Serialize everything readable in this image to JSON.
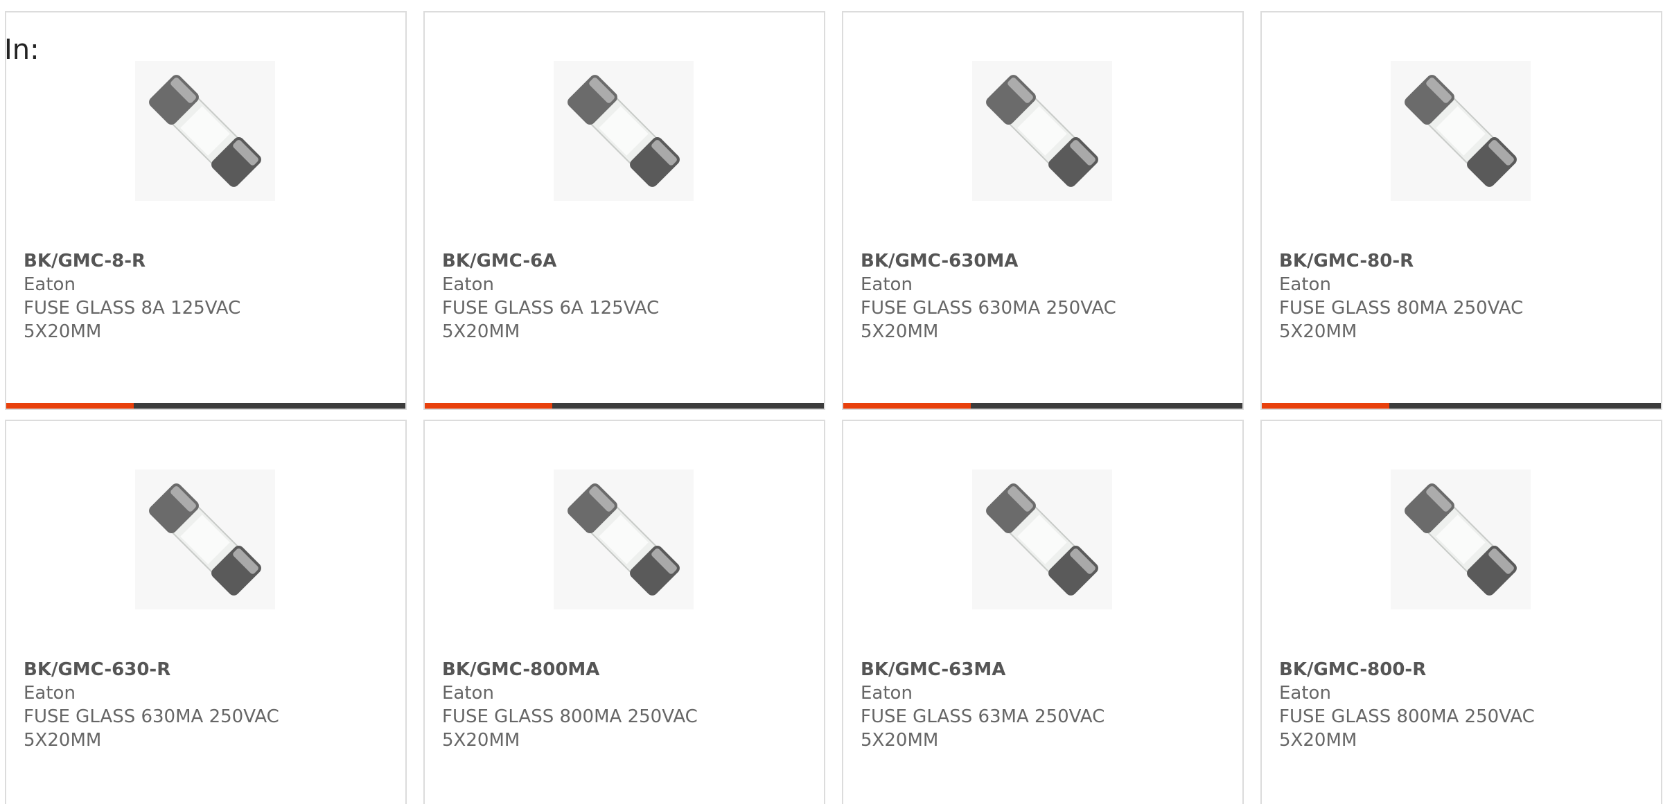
{
  "page": {
    "label": "In:"
  },
  "colors": {
    "accent": "#e8400c",
    "bar_dark": "#3c3c3c",
    "card_border": "#dcdcdc",
    "text": "#555555"
  },
  "products": [
    {
      "part": "BK/GMC-8-R",
      "brand": "Eaton",
      "description": "FUSE GLASS 8A 125VAC 5X20MM",
      "image": "glass-fuse-icon",
      "bar_fill": 0.32
    },
    {
      "part": "BK/GMC-6A",
      "brand": "Eaton",
      "description": "FUSE GLASS 6A 125VAC 5X20MM",
      "image": "glass-fuse-icon",
      "bar_fill": 0.32
    },
    {
      "part": "BK/GMC-630MA",
      "brand": "Eaton",
      "description": "FUSE GLASS 630MA 250VAC 5X20MM",
      "image": "glass-fuse-icon",
      "bar_fill": 0.32
    },
    {
      "part": "BK/GMC-80-R",
      "brand": "Eaton",
      "description": "FUSE GLASS 80MA 250VAC 5X20MM",
      "image": "glass-fuse-icon",
      "bar_fill": 0.32
    },
    {
      "part": "BK/GMC-630-R",
      "brand": "Eaton",
      "description": "FUSE GLASS 630MA 250VAC 5X20MM",
      "image": "glass-fuse-icon",
      "bar_fill": 0.32
    },
    {
      "part": "BK/GMC-800MA",
      "brand": "Eaton",
      "description": "FUSE GLASS 800MA 250VAC 5X20MM",
      "image": "glass-fuse-icon",
      "bar_fill": 0.32
    },
    {
      "part": "BK/GMC-63MA",
      "brand": "Eaton",
      "description": "FUSE GLASS 63MA 250VAC 5X20MM",
      "image": "glass-fuse-icon",
      "bar_fill": 0.32
    },
    {
      "part": "BK/GMC-800-R",
      "brand": "Eaton",
      "description": "FUSE GLASS 800MA 250VAC 5X20MM",
      "image": "glass-fuse-icon",
      "bar_fill": 0.32
    }
  ]
}
